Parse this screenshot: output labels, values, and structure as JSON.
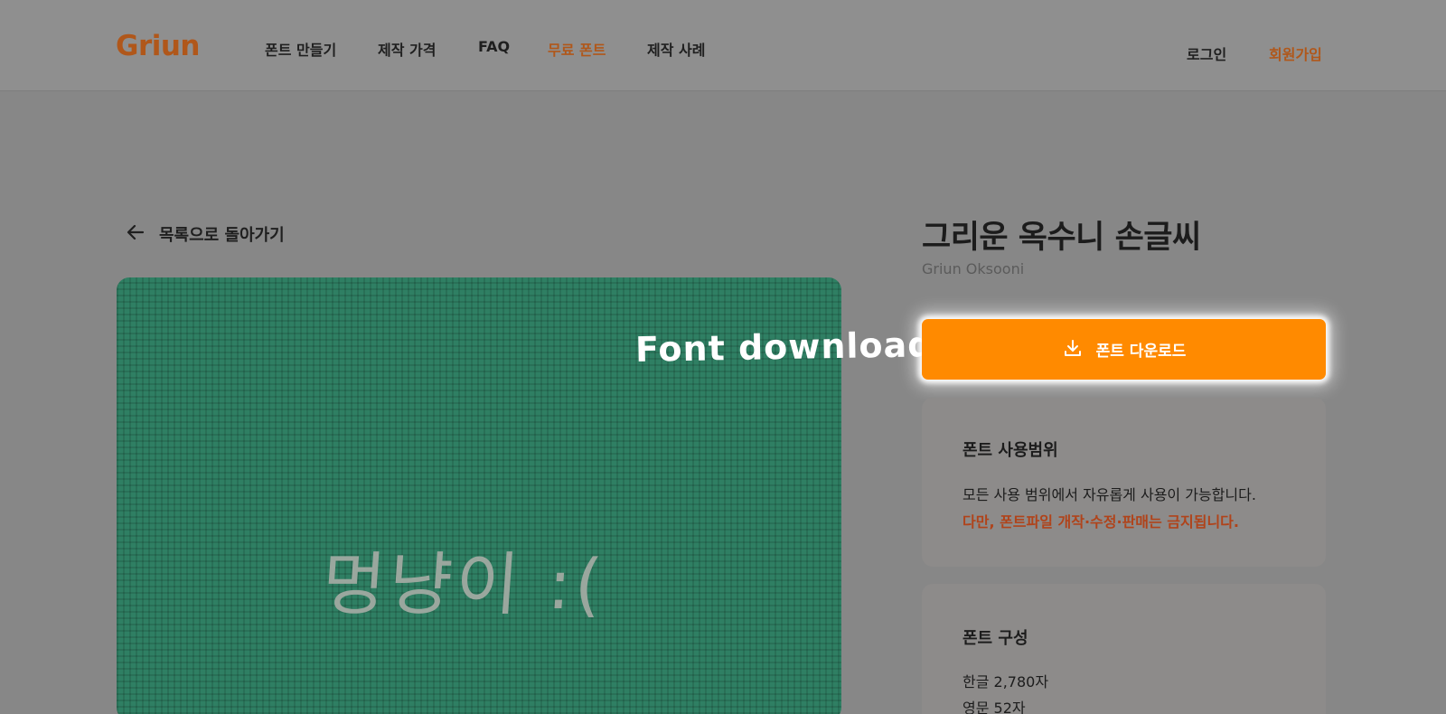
{
  "header": {
    "logo": "Griun",
    "nav": [
      {
        "label": "폰트 만들기"
      },
      {
        "label": "제작 가격"
      },
      {
        "label": "FAQ"
      },
      {
        "label": "무료 폰트"
      },
      {
        "label": "제작 사례"
      }
    ],
    "login_label": "로그인",
    "signup_label": "회원가입"
  },
  "back": {
    "label": "목록으로 돌아가기"
  },
  "preview": {
    "sample_text": "멍냥이 :("
  },
  "overlay": {
    "label": "Font download"
  },
  "font": {
    "title": "그리운 옥수니 손글씨",
    "subtitle": "Griun Oksooni"
  },
  "download": {
    "label": "폰트 다운로드"
  },
  "usage_card": {
    "title": "폰트 사용범위",
    "line1": "모든 사용 범위에서 자유롭게 사용이 가능합니다.",
    "line2": "다만, 폰트파일 개작·수정·판매는 금지됩니다."
  },
  "composition_card": {
    "title": "폰트 구성",
    "line1": "한글 2,780자",
    "line2": "영문 52자"
  },
  "colors": {
    "accent": "#ff8a00",
    "brand": "#b0571a",
    "warning": "#b0431a",
    "preview_bg": "#2f7f63"
  }
}
